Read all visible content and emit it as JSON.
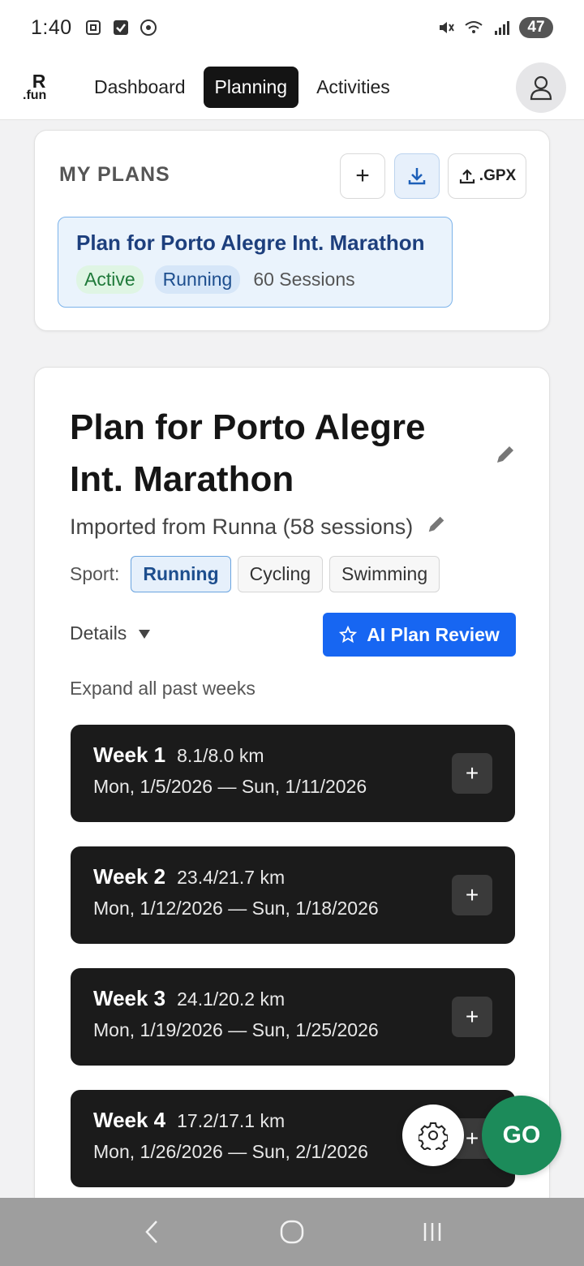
{
  "status_bar": {
    "time": "1:40",
    "battery": "47"
  },
  "header": {
    "logo_top": "R",
    "logo_bottom": ".fun",
    "tabs": [
      {
        "label": "Dashboard",
        "active": false
      },
      {
        "label": "Planning",
        "active": true
      },
      {
        "label": "Activities",
        "active": false
      }
    ]
  },
  "my_plans": {
    "title": "MY PLANS",
    "add_label": "+",
    "gpx_label": ".GPX",
    "plans": [
      {
        "title": "Plan for Porto Alegre Int. Marathon",
        "status": "Active",
        "sport": "Running",
        "sessions": "60 Sessions"
      }
    ]
  },
  "plan_detail": {
    "title": "Plan for Porto Alegre Int. Marathon",
    "subtitle": "Imported from Runna (58 sessions)",
    "sport_label": "Sport:",
    "sports": [
      "Running",
      "Cycling",
      "Swimming"
    ],
    "selected_sport": "Running",
    "details_label": "Details",
    "ai_review_label": "AI Plan Review",
    "expand_label": "Expand all past weeks",
    "weeks": [
      {
        "name": "Week 1",
        "km": "8.1/8.0 km",
        "dates": "Mon, 1/5/2026 — Sun, 1/11/2026"
      },
      {
        "name": "Week 2",
        "km": "23.4/21.7 km",
        "dates": "Mon, 1/12/2026 — Sun, 1/18/2026"
      },
      {
        "name": "Week 3",
        "km": "24.1/20.2 km",
        "dates": "Mon, 1/19/2026 — Sun, 1/25/2026"
      },
      {
        "name": "Week 4",
        "km": "17.2/17.1 km",
        "dates": "Mon, 1/26/2026 — Sun, 2/1/2026"
      }
    ],
    "week_add_label": "+"
  },
  "fab": {
    "go_label": "GO"
  },
  "colors": {
    "accent_blue": "#1766f2",
    "go_green": "#1c8b5a",
    "active_tab": "#141414"
  }
}
